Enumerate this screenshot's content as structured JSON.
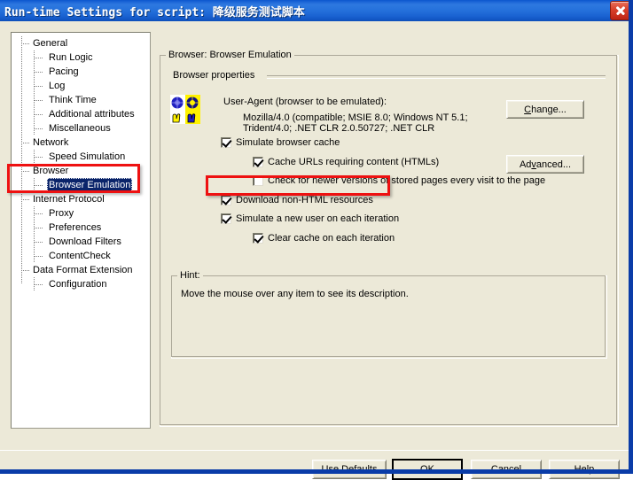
{
  "window": {
    "title": "Run-time Settings for script: 降级服务测试脚本",
    "close_label": "close-window"
  },
  "tree": {
    "items": [
      {
        "label": "General",
        "level": 0,
        "selected": false
      },
      {
        "label": "Run Logic",
        "level": 1,
        "selected": false
      },
      {
        "label": "Pacing",
        "level": 1,
        "selected": false
      },
      {
        "label": "Log",
        "level": 1,
        "selected": false
      },
      {
        "label": "Think Time",
        "level": 1,
        "selected": false
      },
      {
        "label": "Additional attributes",
        "level": 1,
        "selected": false
      },
      {
        "label": "Miscellaneous",
        "level": 1,
        "selected": false
      },
      {
        "label": "Network",
        "level": 0,
        "selected": false
      },
      {
        "label": "Speed Simulation",
        "level": 1,
        "selected": false
      },
      {
        "label": "Browser",
        "level": 0,
        "selected": false
      },
      {
        "label": "Browser Emulation",
        "level": 1,
        "selected": true
      },
      {
        "label": "Internet Protocol",
        "level": 0,
        "selected": false
      },
      {
        "label": "Proxy",
        "level": 1,
        "selected": false
      },
      {
        "label": "Preferences",
        "level": 1,
        "selected": false
      },
      {
        "label": "Download Filters",
        "level": 1,
        "selected": false
      },
      {
        "label": "ContentCheck",
        "level": 1,
        "selected": false
      },
      {
        "label": "Data Format Extension",
        "level": 0,
        "selected": false
      },
      {
        "label": "Configuration",
        "level": 1,
        "selected": false
      }
    ]
  },
  "main": {
    "group_title": "Browser: Browser Emulation",
    "properties_label": "Browser properties",
    "user_agent_label": "User-Agent (browser to be emulated):",
    "user_agent_line1": "Mozilla/4.0 (compatible; MSIE 8.0; Windows NT 5.1;",
    "user_agent_line2": "Trident/4.0; .NET CLR 2.0.50727; .NET CLR",
    "change_button": "Change...",
    "advanced_button": "Advanced...",
    "checkboxes": [
      {
        "label": "Simulate browser cache",
        "checked": true
      },
      {
        "label": "Cache URLs requiring content (HTMLs)",
        "checked": true
      },
      {
        "label": "Check for newer versions of stored pages every visit to the page",
        "checked": false
      },
      {
        "label": "Download non-HTML resources",
        "checked": true
      },
      {
        "label": "Simulate a new user on each iteration",
        "checked": true
      },
      {
        "label": "Clear cache on each iteration",
        "checked": true
      }
    ]
  },
  "hint": {
    "title": "Hint:",
    "text": "Move the mouse over any item to see its description."
  },
  "footer": {
    "use_defaults": "Use Defaults",
    "ok": "OK",
    "cancel": "Cancel",
    "help": "Help"
  },
  "annotations": {
    "color": "#EE1111",
    "box1_target": "Browser Emulation tree node",
    "box2_target": "Download non-HTML resources checkbox"
  }
}
